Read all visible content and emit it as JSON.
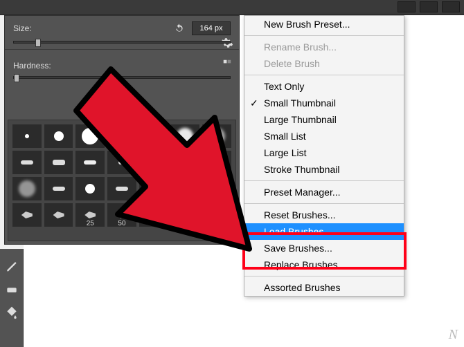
{
  "topbar": {
    "size_value_small": "164"
  },
  "panel": {
    "size_label": "Size:",
    "size_value": "164 px",
    "hardness_label": "Hardness:",
    "swatch_labels": {
      "s25": "25",
      "s50": "50"
    }
  },
  "menu": {
    "new_preset": "New Brush Preset...",
    "rename": "Rename Brush...",
    "delete": "Delete Brush",
    "text_only": "Text Only",
    "small_thumb": "Small Thumbnail",
    "large_thumb": "Large Thumbnail",
    "small_list": "Small List",
    "large_list": "Large List",
    "stroke_thumb": "Stroke Thumbnail",
    "preset_mgr": "Preset Manager...",
    "reset": "Reset Brushes...",
    "load": "Load Brushes...",
    "save": "Save Brushes...",
    "replace": "Replace Brushes...",
    "assorted": "Assorted Brushes"
  },
  "watermark": "N"
}
